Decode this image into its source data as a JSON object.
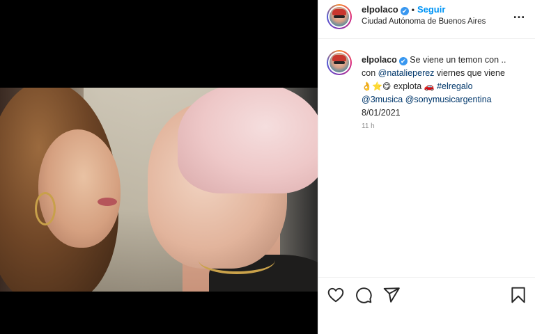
{
  "post": {
    "username": "elpolaco",
    "verified_mark": "✔",
    "separator": "•",
    "follow_label": "Seguir",
    "location": "Ciudad Autónoma de Buenos Aires",
    "more_label": "…"
  },
  "caption": {
    "username": "elpolaco",
    "line1_text": "Se viene un temon con ..",
    "line2_prefix": "con ",
    "mention1": "@natalieperez",
    "line2_suffix": " viernes que viene",
    "emojis1": "👌⭐😋",
    "word_explota": " explota ",
    "emoji_car": "🚗",
    "hashtag": "#elregalo",
    "mention2": "@3musica",
    "mention3": "@sonymusicargentina",
    "date": "8/01/2021"
  },
  "timestamp": "11 h",
  "icons": [
    "heart-icon",
    "comment-icon",
    "share-icon",
    "bookmark-icon",
    "verified-badge-icon",
    "more-options-icon"
  ],
  "colors": {
    "accent_blue": "#0095f6",
    "link_blue": "#00376b",
    "verified_blue": "#3897f0",
    "text": "#262626",
    "muted": "#8e8e8e",
    "border": "#efefef"
  }
}
